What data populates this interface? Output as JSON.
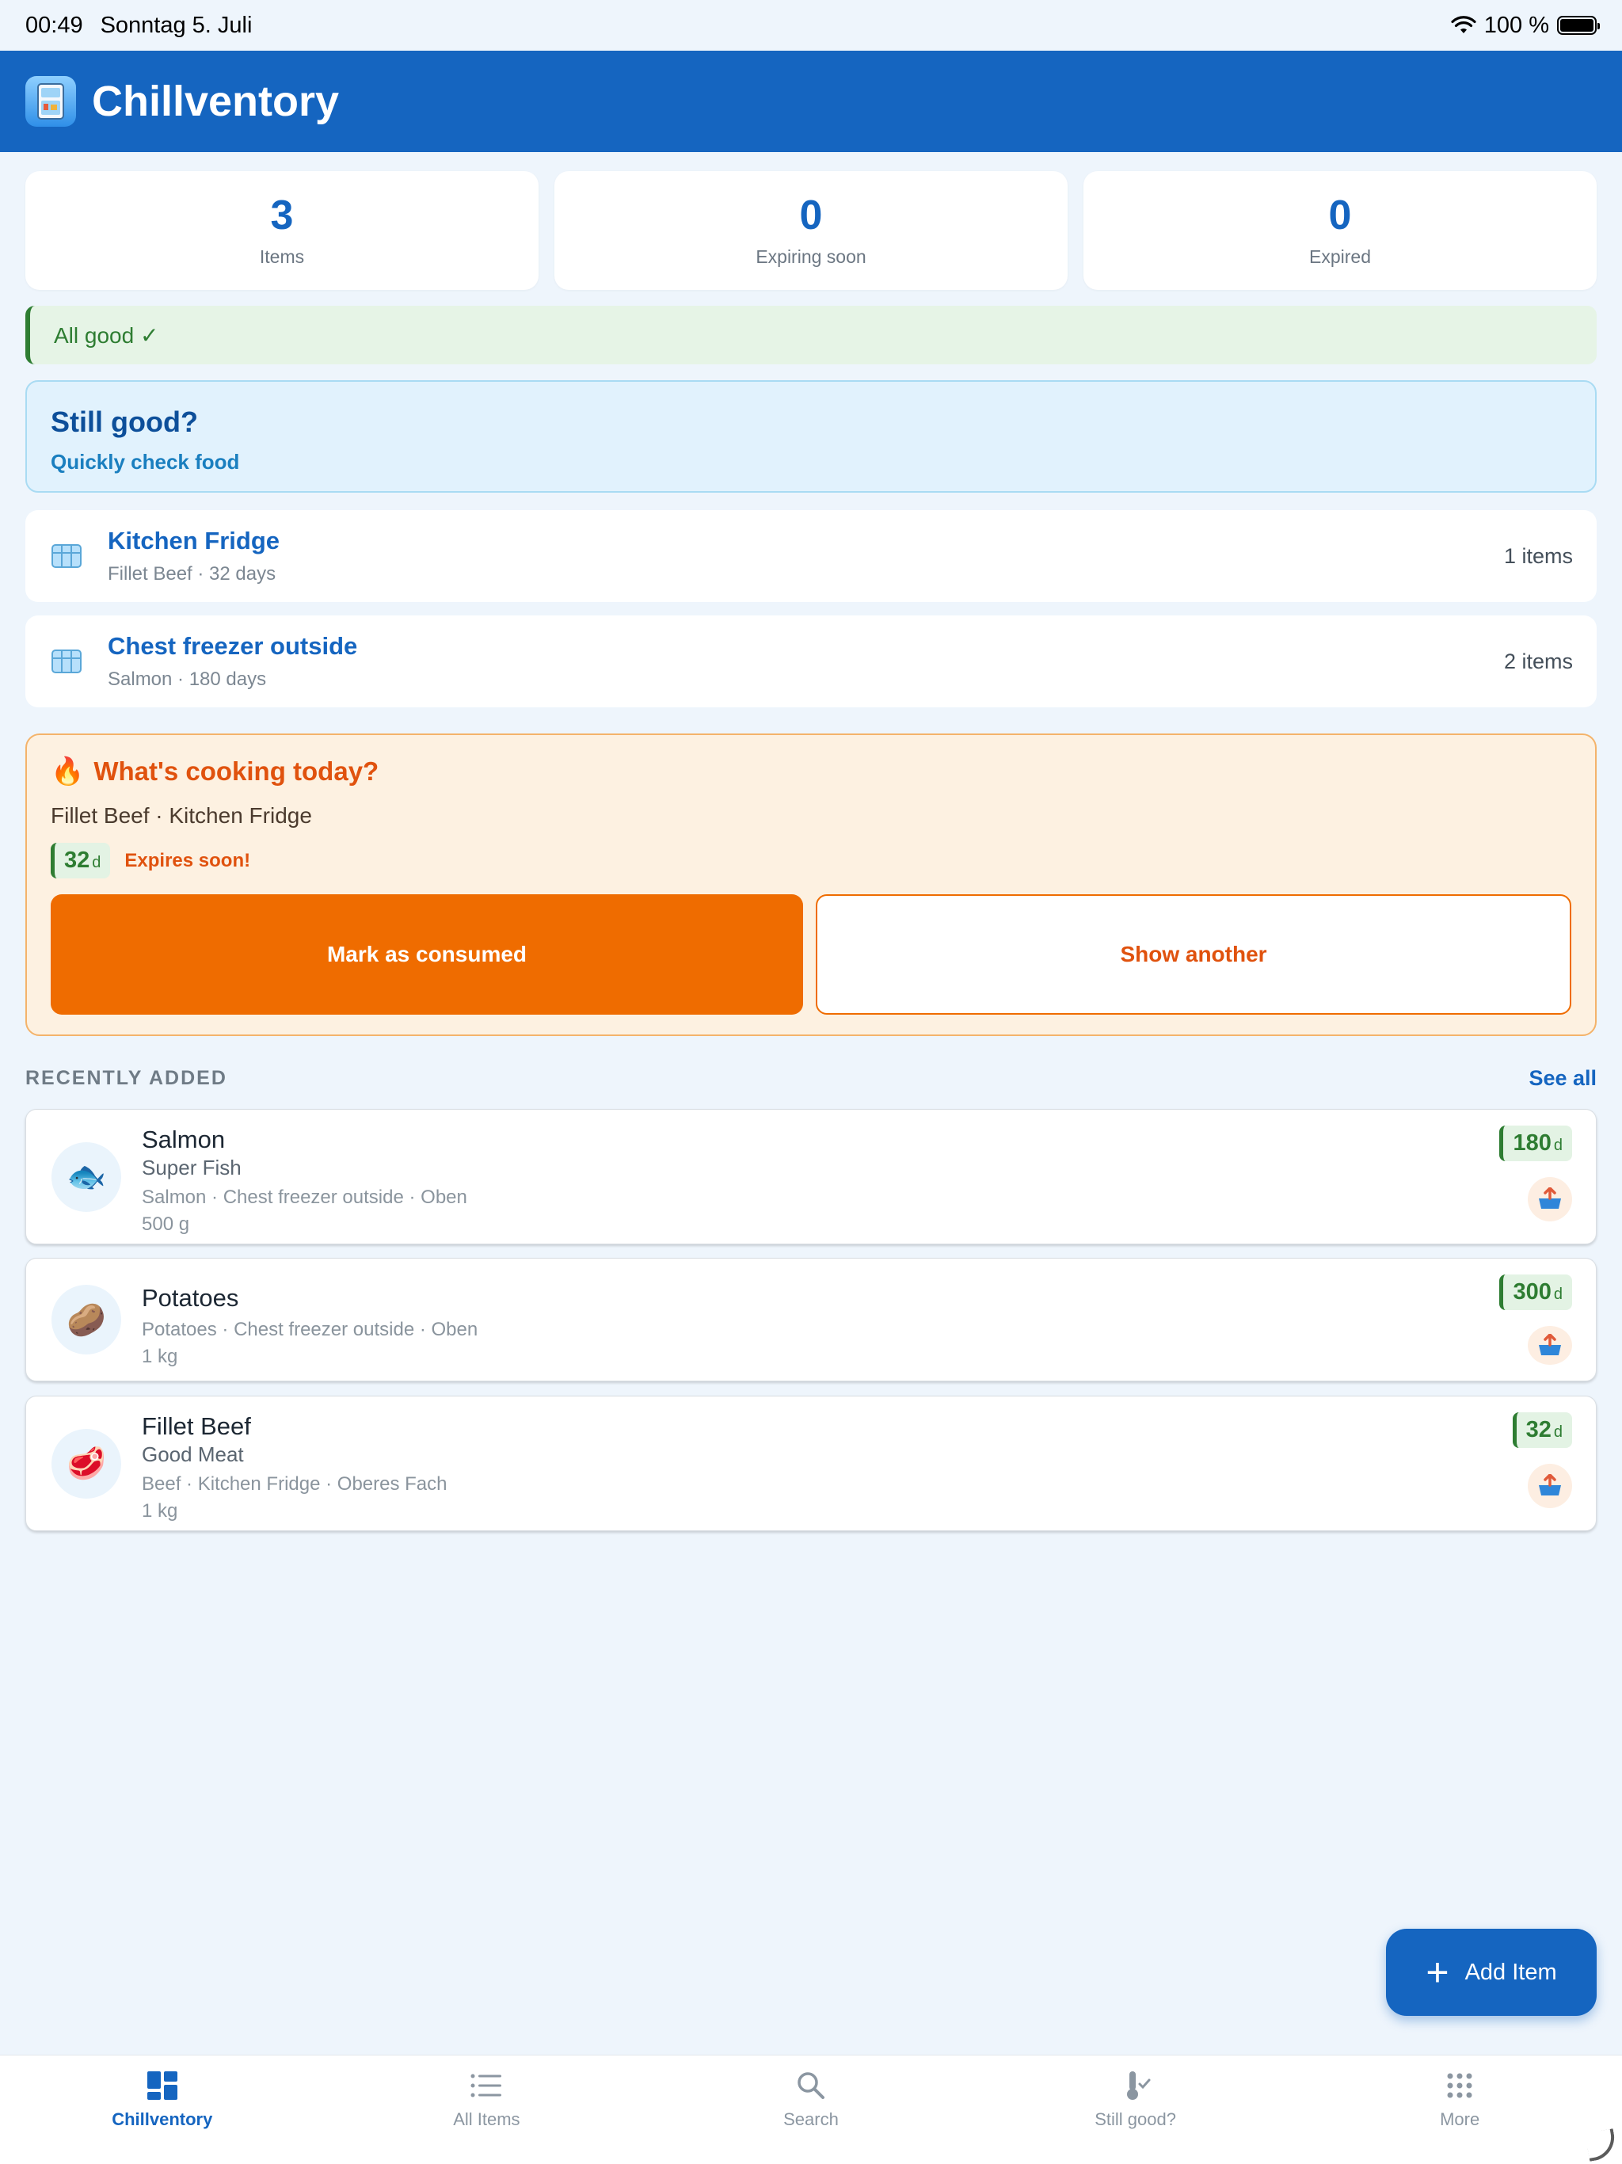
{
  "status": {
    "time": "00:49",
    "date": "Sonntag 5. Juli",
    "battery": "100 %"
  },
  "app": {
    "title": "Chillventory"
  },
  "stats": [
    {
      "value": "3",
      "label": "Items"
    },
    {
      "value": "0",
      "label": "Expiring soon"
    },
    {
      "value": "0",
      "label": "Expired"
    }
  ],
  "alert": {
    "text": "All good ✓"
  },
  "still_good": {
    "title": "Still good?",
    "subtitle": "Quickly check food"
  },
  "locations": [
    {
      "name": "Kitchen Fridge",
      "sub": "Fillet Beef · 32 days",
      "count": "1 items",
      "icon": "freezer-box-icon"
    },
    {
      "name": "Chest freezer outside",
      "sub": "Salmon · 180 days",
      "count": "2 items",
      "icon": "freezer-box-icon"
    }
  ],
  "cooking": {
    "emoji": "🔥",
    "title": "What's cooking today?",
    "meta": "Fillet Beef · Kitchen Fridge",
    "days": "32",
    "unit": "d",
    "warning": "Expires soon!",
    "primary_label": "Mark as consumed",
    "secondary_label": "Show another"
  },
  "recent": {
    "label": "RECENTLY ADDED",
    "see_all": "See all",
    "items": [
      {
        "name": "Salmon",
        "brand": "Super Fish",
        "where": "Salmon · Chest freezer outside · Oben",
        "qty": "500 g",
        "days": "180",
        "unit": "d",
        "emoji": "🐟"
      },
      {
        "name": "Potatoes",
        "brand": "",
        "where": "Potatoes · Chest freezer outside · Oben",
        "qty": "1 kg",
        "days": "300",
        "unit": "d",
        "emoji": "🥔"
      },
      {
        "name": "Fillet Beef",
        "brand": "Good Meat",
        "where": "Beef · Kitchen Fridge · Oberes Fach",
        "qty": "1 kg",
        "days": "32",
        "unit": "d",
        "emoji": "🥩"
      }
    ]
  },
  "fab": {
    "label": "Add Item"
  },
  "tabs": [
    {
      "label": "Chillventory",
      "icon": "dashboard-icon",
      "active": true
    },
    {
      "label": "All Items",
      "icon": "list-icon",
      "active": false
    },
    {
      "label": "Search",
      "icon": "search-icon",
      "active": false
    },
    {
      "label": "Still good?",
      "icon": "thermometer-check-icon",
      "active": false
    },
    {
      "label": "More",
      "icon": "grid-dots-icon",
      "active": false
    }
  ],
  "colors": {
    "primary": "#1565c0",
    "accent": "#ef6c00",
    "success": "#2e7d32",
    "background": "#eef5fc"
  }
}
